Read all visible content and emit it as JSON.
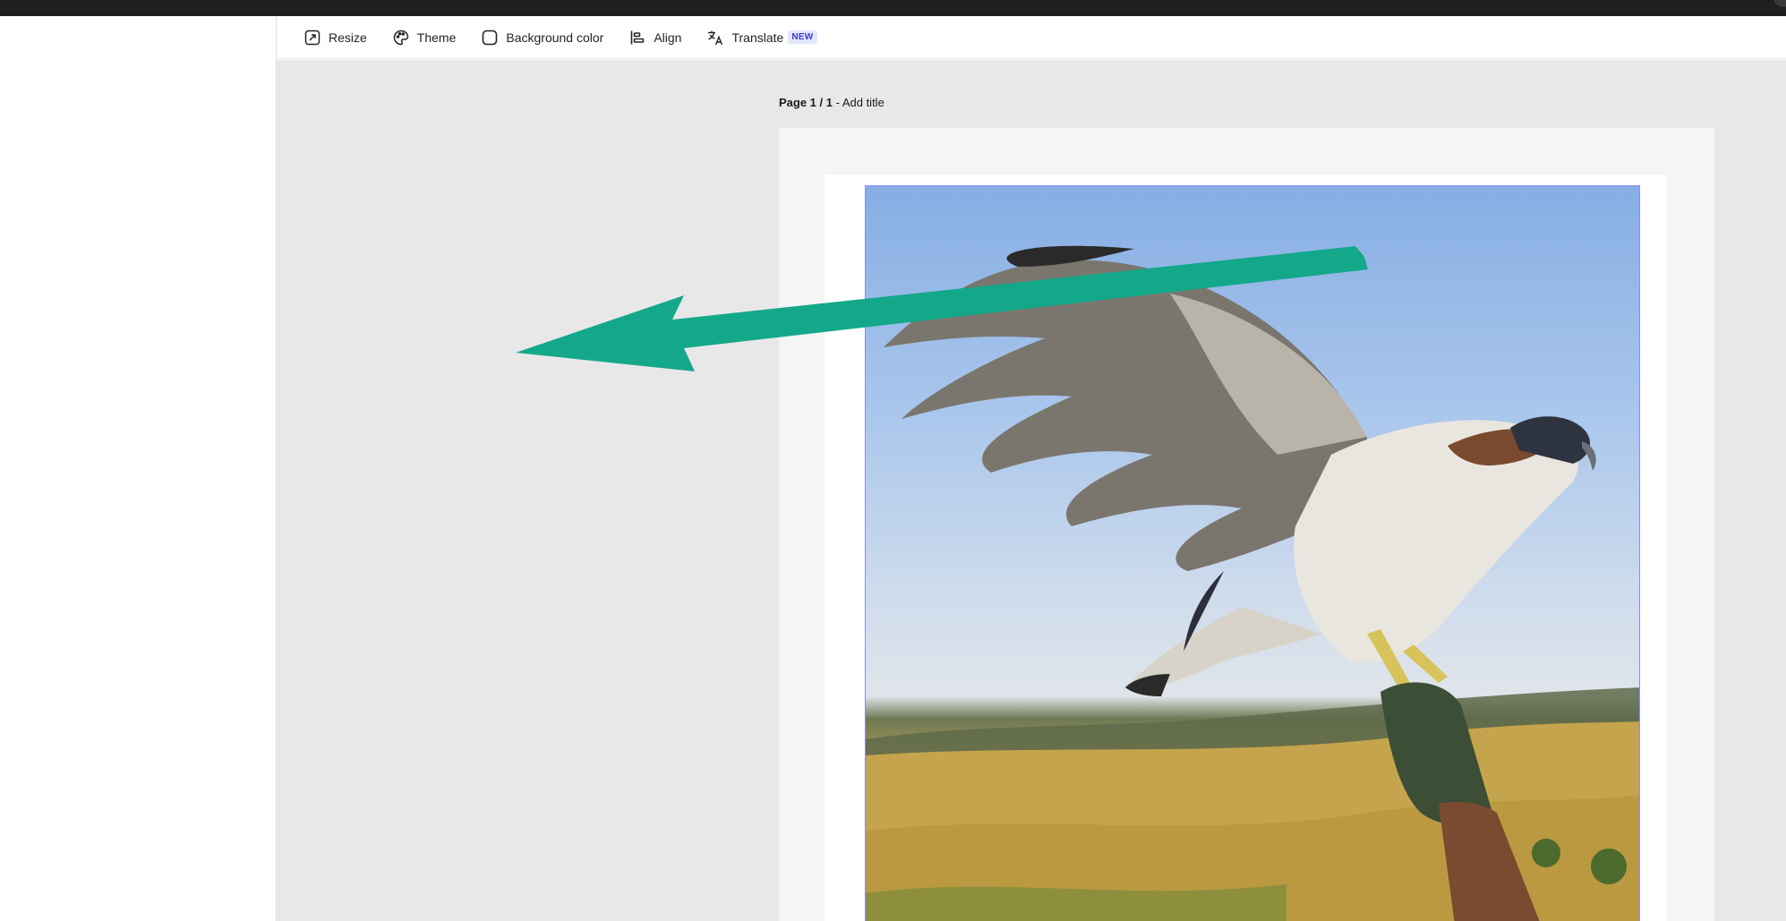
{
  "toolbar": {
    "items": [
      {
        "label": "Resize",
        "icon": "resize-icon"
      },
      {
        "label": "Theme",
        "icon": "palette-icon"
      },
      {
        "label": "Background color",
        "icon": "background-color-icon"
      },
      {
        "label": "Align",
        "icon": "align-left-icon"
      },
      {
        "label": "Translate",
        "icon": "translate-icon",
        "badge": "NEW"
      }
    ]
  },
  "page": {
    "number_label": "Page 1 / 1",
    "separator": " - ",
    "add_title": "Add title"
  },
  "colors": {
    "arrow": "#13a88a",
    "selection_border": "#8a8aff",
    "badge_text": "#3d3dcf",
    "badge_bg": "#e3e6ff"
  }
}
